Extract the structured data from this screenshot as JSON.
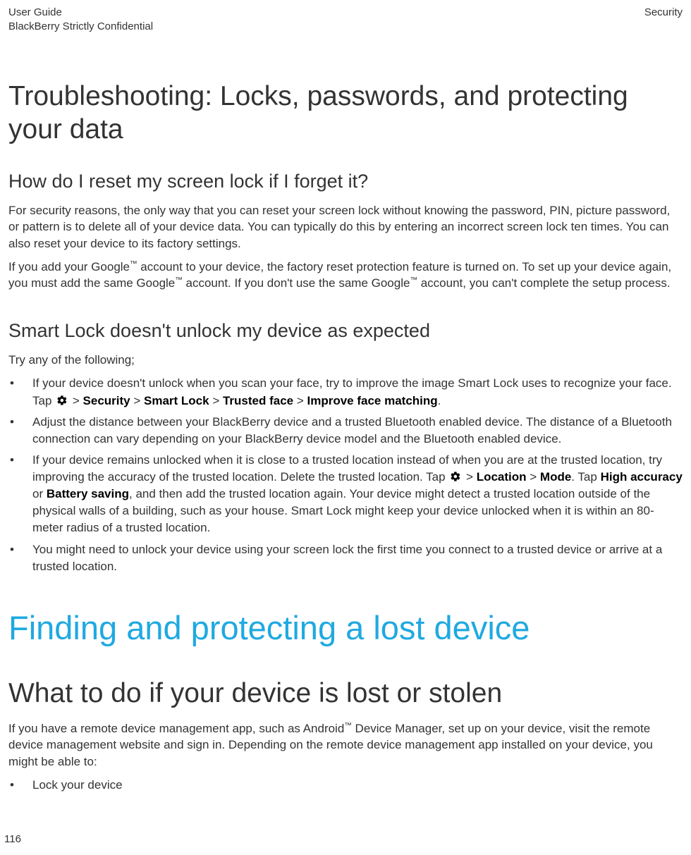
{
  "header": {
    "leftLine1": "User Guide",
    "leftLine2": "BlackBerry Strictly Confidential",
    "right": "Security"
  },
  "h1": "Troubleshooting: Locks, passwords, and protecting your data",
  "reset": {
    "h2": "How do I reset my screen lock if I forget it?",
    "p1": "For security reasons, the only way that you can reset your screen lock without knowing the password, PIN, picture password, or pattern is to delete all of your device data. You can typically do this by entering an incorrect screen lock ten times. You can also reset your device to its factory settings.",
    "p2a": "If you add your Google",
    "p2b": " account to your device, the factory reset protection feature is turned on. To set up your device again, you must add the same Google",
    "p2c": " account. If you don't use the same Google",
    "p2d": " account, you can't complete the setup process."
  },
  "smartlock": {
    "h2": "Smart Lock doesn't unlock my device as expected",
    "intro": "Try any of the following;",
    "li1a": "If your device doesn't unlock when you scan your face, try to improve the image Smart Lock uses to recognize your face. Tap ",
    "li1_path": "Security",
    "li1_smartlock": "Smart Lock",
    "li1_trusted": "Trusted face",
    "li1_improve": "Improve face matching",
    "li2": "Adjust the distance between your BlackBerry device and a trusted Bluetooth enabled device. The distance of a Bluetooth connection can vary depending on your BlackBerry device model and the Bluetooth enabled device.",
    "li3a": "If your device remains unlocked when it is close to a trusted location instead of when you are at the trusted location, try improving the accuracy of the trusted location. Delete the trusted location. Tap ",
    "li3_location": "Location",
    "li3_mode": "Mode",
    "li3_tap": ". Tap ",
    "li3_high": "High accuracy",
    "li3_or": " or ",
    "li3_battery": "Battery saving",
    "li3b": ", and then add the trusted location again. Your device might detect a trusted location outside of the physical walls of a building, such as your house. Smart Lock might keep your device unlocked when it is within an 80-meter radius of a trusted location.",
    "li4": "You might need to unlock your device using your screen lock the first time you connect to a trusted device or arrive at a trusted location."
  },
  "lost": {
    "chapter": "Finding and protecting a lost device",
    "h1": "What to do if your device is lost or stolen",
    "p1a": "If you have a remote device management app, such as Android",
    "p1b": " Device Manager, set up on your device, visit the remote device management website and sign in. Depending on the remote device management app installed on your device, you might be able to:",
    "li1": "Lock your device"
  },
  "gt": " > ",
  "tm": "™",
  "period": ".",
  "pageNumber": "116"
}
